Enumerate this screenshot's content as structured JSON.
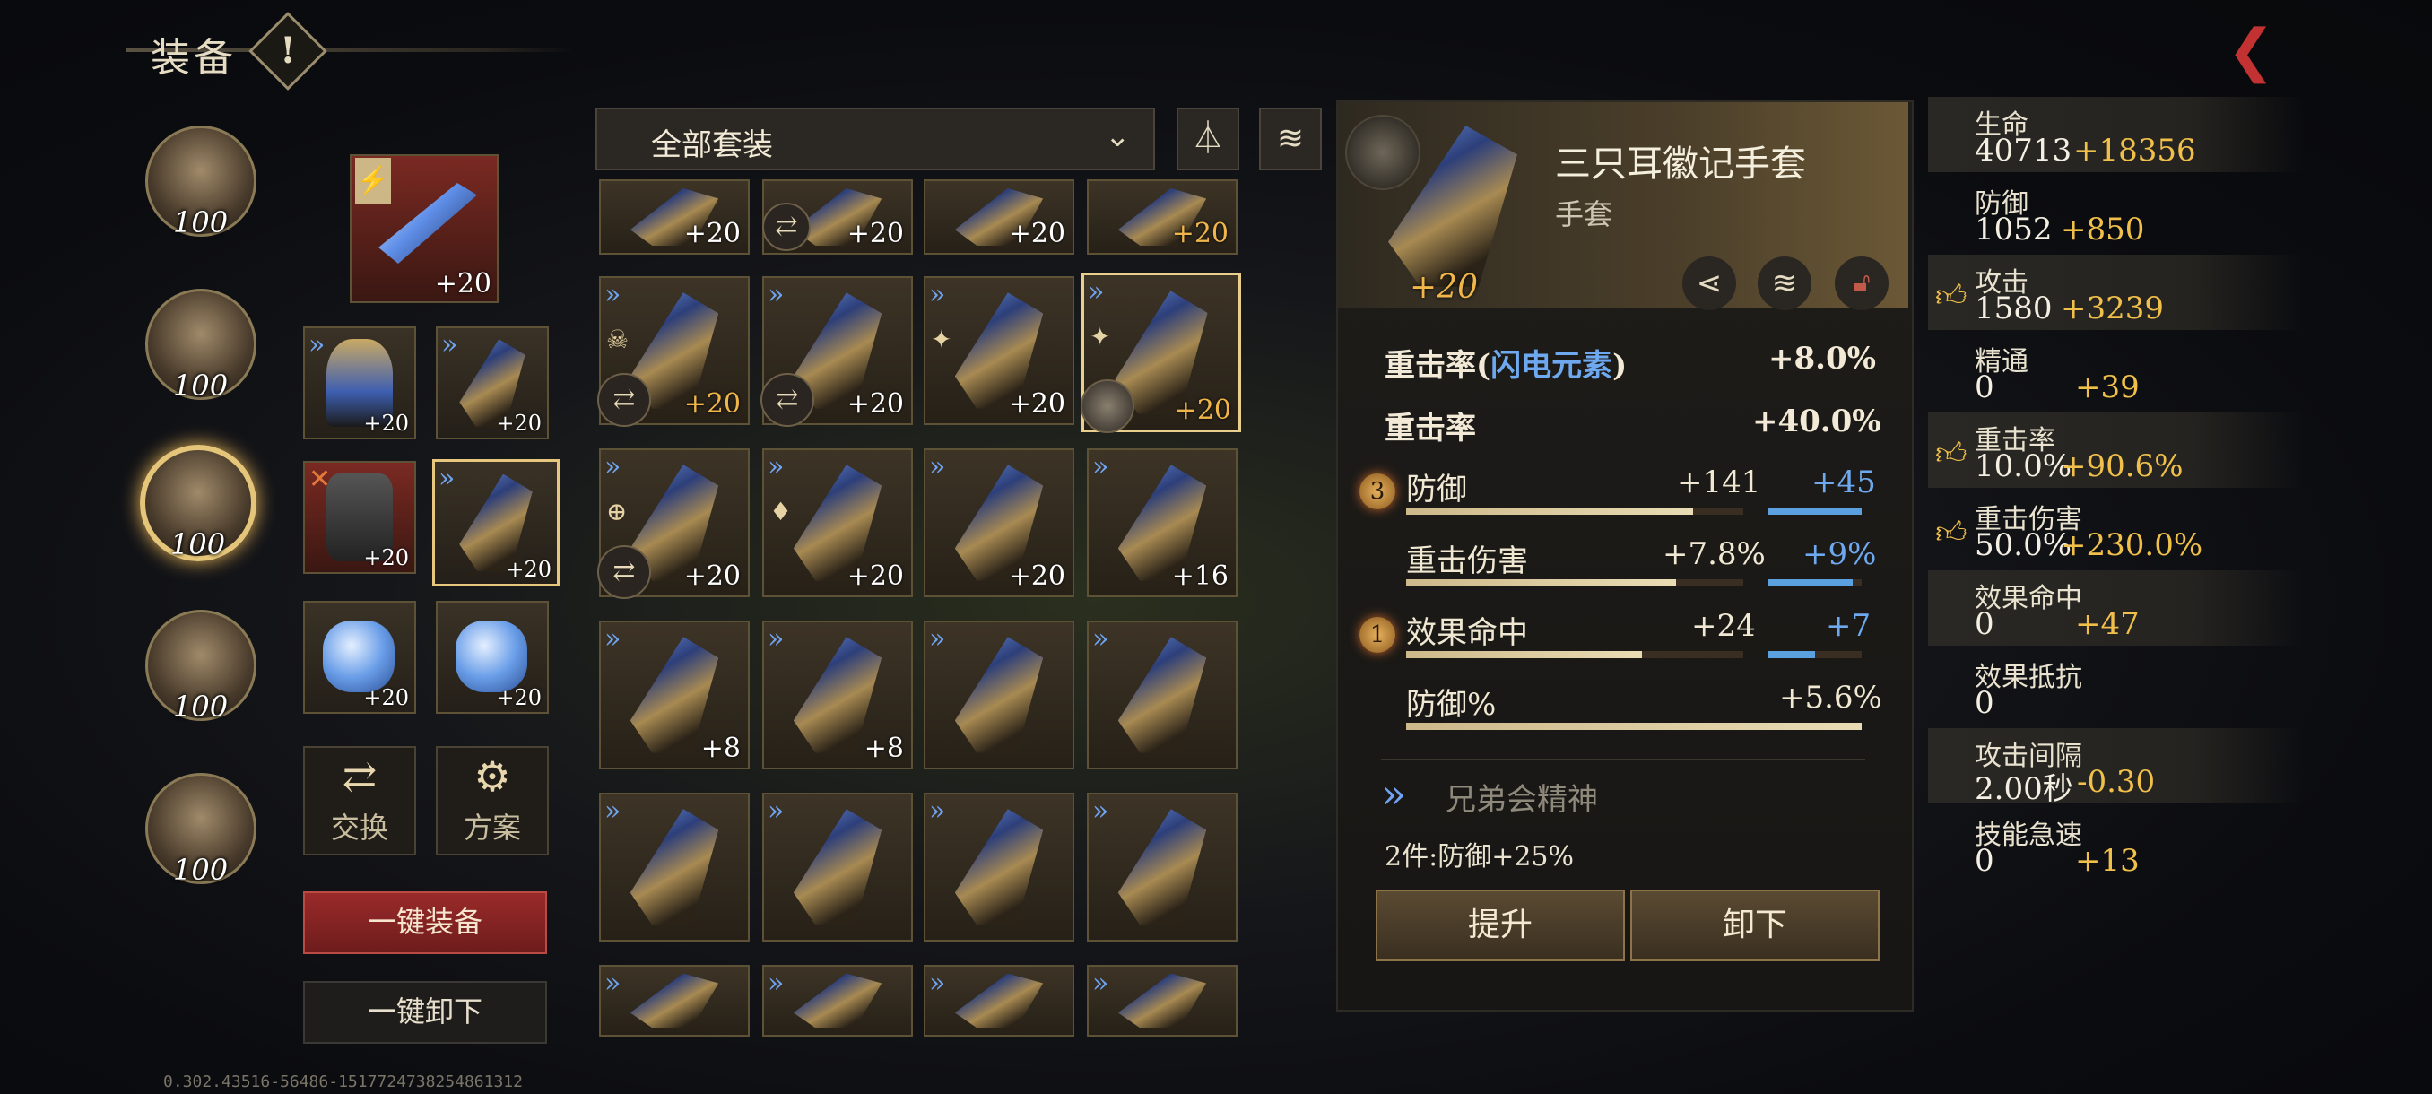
{
  "header": {
    "title": "装备",
    "warn_symbol": "!",
    "back_icon": "back-arrow-icon"
  },
  "heroes": [
    {
      "level": "100"
    },
    {
      "level": "100"
    },
    {
      "level": "100",
      "selected": true
    },
    {
      "level": "100"
    },
    {
      "level": "100"
    }
  ],
  "equipped": {
    "weapon_plus": "+20",
    "slots": [
      {
        "plus": "+20"
      },
      {
        "plus": "+20"
      },
      {
        "plus": "+20"
      },
      {
        "plus": "+20",
        "selected": true
      },
      {
        "plus": "+20"
      },
      {
        "plus": "+20"
      }
    ],
    "swap_label": "交换",
    "plan_label": "方案",
    "equip_all": "一键装备",
    "unequip_all": "一键卸下"
  },
  "filter": {
    "dropdown": "全部套装",
    "chevron": "chevron-down-icon",
    "filter_icon": "filter-icon",
    "stack_icon": "stack-icon"
  },
  "grid": {
    "row0": [
      "+20",
      "+20",
      "+20",
      "+20"
    ],
    "row1": [
      "+20",
      "+20",
      "+20",
      "+20"
    ],
    "row2": [
      "+20",
      "+20",
      "+20",
      "+16"
    ],
    "row3": [
      "+8",
      "+8",
      "",
      ""
    ]
  },
  "detail": {
    "name": "三只耳徽记手套",
    "type": "手套",
    "plus": "+20",
    "main_stats": [
      {
        "label": "重击率(",
        "highlight": "闪电元素",
        "label_end": ")",
        "value": "+8.0%"
      },
      {
        "label": "重击率",
        "value": "+40.0%"
      }
    ],
    "sub_stats": [
      {
        "badge": "3",
        "label": "防御",
        "value": "+141",
        "bonus": "+45",
        "fill": 0.85,
        "bonus_fill": 1.0
      },
      {
        "badge": "",
        "label": "重击伤害",
        "value": "+7.8%",
        "bonus": "+9%",
        "fill": 0.8,
        "bonus_fill": 0.9
      },
      {
        "badge": "1",
        "label": "效果命中",
        "value": "+24",
        "bonus": "+7",
        "fill": 0.7,
        "bonus_fill": 0.5
      },
      {
        "badge": "",
        "label": "防御%",
        "value": "+5.6%",
        "bonus": "",
        "fill": 1.0,
        "bonus_fill": 0
      }
    ],
    "set_name": "兄弟会精神",
    "set_effect": "2件:防御+25%",
    "upgrade": "提升",
    "unequip": "卸下"
  },
  "attributes": [
    {
      "name": "生命",
      "value": "40713",
      "bonus": "+18356",
      "thumb": false
    },
    {
      "name": "防御",
      "value": "1052",
      "bonus": "+850",
      "thumb": false
    },
    {
      "name": "攻击",
      "value": "1580",
      "bonus": "+3239",
      "thumb": true
    },
    {
      "name": "精通",
      "value": "0",
      "bonus": "+39",
      "thumb": false
    },
    {
      "name": "重击率",
      "value": "10.0%",
      "bonus": "+90.6%",
      "thumb": true
    },
    {
      "name": "重击伤害",
      "value": "50.0%",
      "bonus": "+230.0%",
      "thumb": true
    },
    {
      "name": "效果命中",
      "value": "0",
      "bonus": "+47",
      "thumb": false
    },
    {
      "name": "效果抵抗",
      "value": "0",
      "bonus": "",
      "thumb": false
    },
    {
      "name": "攻击间隔",
      "value": "2.00秒",
      "bonus": "-0.30",
      "thumb": false
    },
    {
      "name": "技能急速",
      "value": "0",
      "bonus": "+13",
      "thumb": false
    }
  ],
  "version": "0.302.43516-56486-1517724738254861312"
}
